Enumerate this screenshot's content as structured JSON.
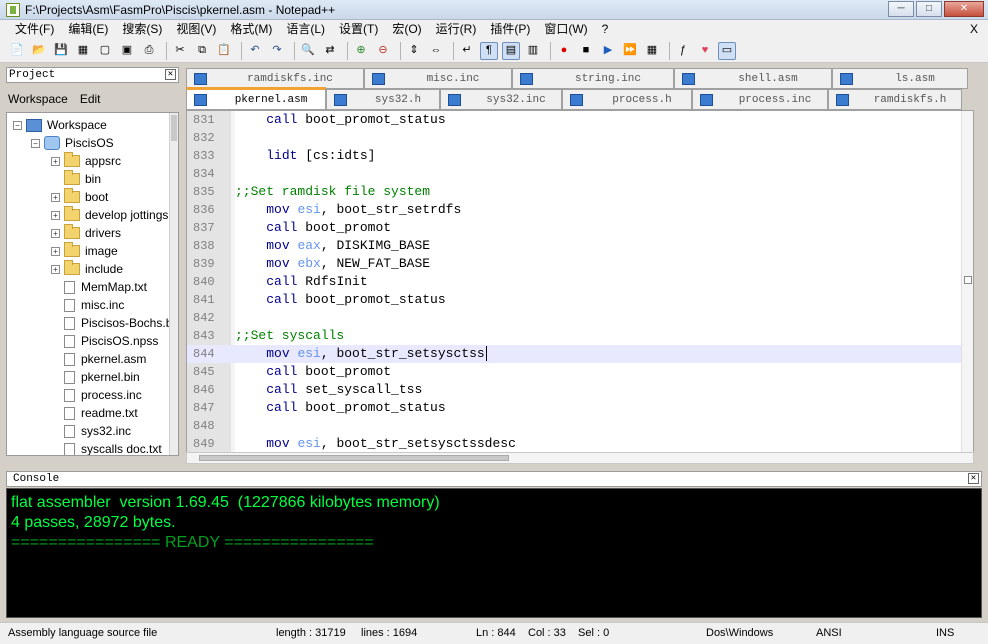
{
  "window": {
    "title": "F:\\Projects\\Asm\\FasmPro\\Piscis\\pkernel.asm - Notepad++",
    "minimize": "─",
    "maximize": "□",
    "close": "✕"
  },
  "menu": {
    "items": [
      "文件(F)",
      "编辑(E)",
      "搜索(S)",
      "视图(V)",
      "格式(M)",
      "语言(L)",
      "设置(T)",
      "宏(O)",
      "运行(R)",
      "插件(P)",
      "窗口(W)",
      "?"
    ],
    "close_label": "X"
  },
  "toolbar": {
    "icons": [
      "new-file-icon",
      "open-file-icon",
      "save-icon",
      "save-all-icon",
      "close-icon",
      "close-all-icon",
      "print-icon",
      "cut-icon",
      "copy-icon",
      "paste-icon",
      "undo-icon",
      "redo-icon",
      "find-icon",
      "replace-icon",
      "zoom-in-icon",
      "zoom-out-icon",
      "sync-v-icon",
      "sync-h-icon",
      "wrap-icon",
      "show-all-chars-icon",
      "indent-guide-icon",
      "doc-map-icon",
      "record-macro-icon",
      "stop-record-icon",
      "play-macro-icon",
      "run-macro-multiple-icon",
      "save-macro-icon",
      "function-list-icon",
      "favorite-icon",
      "console-icon"
    ]
  },
  "project": {
    "header": "Project",
    "menu": [
      "Workspace",
      "Edit"
    ],
    "tree": [
      {
        "label": "Workspace",
        "type": "workspace",
        "level": 0,
        "expander": "−"
      },
      {
        "label": "PiscisOS",
        "type": "project",
        "level": 1,
        "expander": "−"
      },
      {
        "label": "appsrc",
        "type": "folder",
        "level": 2,
        "expander": "+"
      },
      {
        "label": "bin",
        "type": "folder",
        "level": 2,
        "expander": ""
      },
      {
        "label": "boot",
        "type": "folder",
        "level": 2,
        "expander": "+"
      },
      {
        "label": "develop jottings",
        "type": "folder",
        "level": 2,
        "expander": "+"
      },
      {
        "label": "drivers",
        "type": "folder",
        "level": 2,
        "expander": "+"
      },
      {
        "label": "image",
        "type": "folder",
        "level": 2,
        "expander": "+"
      },
      {
        "label": "include",
        "type": "folder",
        "level": 2,
        "expander": "+"
      },
      {
        "label": "MemMap.txt",
        "type": "file",
        "level": 2,
        "expander": ""
      },
      {
        "label": "misc.inc",
        "type": "file",
        "level": 2,
        "expander": ""
      },
      {
        "label": "Piscisos-Bochs.bxrc",
        "type": "file",
        "level": 2,
        "expander": ""
      },
      {
        "label": "PiscisOS.npss",
        "type": "file",
        "level": 2,
        "expander": ""
      },
      {
        "label": "pkernel.asm",
        "type": "file",
        "level": 2,
        "expander": ""
      },
      {
        "label": "pkernel.bin",
        "type": "file",
        "level": 2,
        "expander": ""
      },
      {
        "label": "process.inc",
        "type": "file",
        "level": 2,
        "expander": ""
      },
      {
        "label": "readme.txt",
        "type": "file",
        "level": 2,
        "expander": ""
      },
      {
        "label": "sys32.inc",
        "type": "file",
        "level": 2,
        "expander": ""
      },
      {
        "label": "syscalls doc.txt",
        "type": "file",
        "level": 2,
        "expander": ""
      }
    ]
  },
  "tabs_row1": [
    "ramdiskfs.inc",
    "misc.inc",
    "string.inc",
    "shell.asm",
    "ls.asm"
  ],
  "tabs_row2": [
    "pkernel.asm",
    "sys32.h",
    "sys32.inc",
    "process.h",
    "process.inc",
    "ramdiskfs.h"
  ],
  "active_tab": "pkernel.asm",
  "editor": {
    "lines": [
      {
        "n": "831",
        "ind": "    ",
        "kw": "call",
        "rest": " boot_promot_status",
        "cm": ""
      },
      {
        "n": "832",
        "ind": "",
        "kw": "",
        "rest": "",
        "cm": ""
      },
      {
        "n": "833",
        "ind": "    ",
        "kw": "lidt",
        "rest": " [cs:idts]",
        "cm": ""
      },
      {
        "n": "834",
        "ind": "",
        "kw": "",
        "rest": "",
        "cm": ""
      },
      {
        "n": "835",
        "ind": "",
        "kw": "",
        "rest": "",
        "cm": ";;Set ramdisk file system"
      },
      {
        "n": "836",
        "ind": "    ",
        "kw": "mov",
        "reg": "esi",
        "rest": ", boot_str_setrdfs",
        "cm": ""
      },
      {
        "n": "837",
        "ind": "    ",
        "kw": "call",
        "rest": " boot_promot",
        "cm": ""
      },
      {
        "n": "838",
        "ind": "    ",
        "kw": "mov",
        "reg": "eax",
        "rest": ", DISKIMG_BASE",
        "cm": ""
      },
      {
        "n": "839",
        "ind": "    ",
        "kw": "mov",
        "reg": "ebx",
        "rest": ", NEW_FAT_BASE",
        "cm": ""
      },
      {
        "n": "840",
        "ind": "    ",
        "kw": "call",
        "rest": " RdfsInit",
        "cm": ""
      },
      {
        "n": "841",
        "ind": "    ",
        "kw": "call",
        "rest": " boot_promot_status",
        "cm": ""
      },
      {
        "n": "842",
        "ind": "",
        "kw": "",
        "rest": "",
        "cm": ""
      },
      {
        "n": "843",
        "ind": "",
        "kw": "",
        "rest": "",
        "cm": ";;Set syscalls"
      },
      {
        "n": "844",
        "ind": "    ",
        "kw": "mov",
        "reg": "esi",
        "rest": ", boot_str_setsysctss",
        "cm": "",
        "current": true
      },
      {
        "n": "845",
        "ind": "    ",
        "kw": "call",
        "rest": " boot_promot",
        "cm": ""
      },
      {
        "n": "846",
        "ind": "    ",
        "kw": "call",
        "rest": " set_syscall_tss",
        "cm": ""
      },
      {
        "n": "847",
        "ind": "    ",
        "kw": "call",
        "rest": " boot_promot_status",
        "cm": ""
      },
      {
        "n": "848",
        "ind": "",
        "kw": "",
        "rest": "",
        "cm": ""
      },
      {
        "n": "849",
        "ind": "    ",
        "kw": "mov",
        "reg": "esi",
        "rest": ", boot_str_setsysctssdesc",
        "cm": ""
      }
    ]
  },
  "console": {
    "header": "Console",
    "lines": [
      "flat assembler  version 1.69.45  (1227866 kilobytes memory)",
      "4 passes, 28972 bytes.",
      "================ READY ================"
    ]
  },
  "status": {
    "type": "Assembly language source file",
    "length": "length : 31719",
    "lines": "lines : 1694",
    "ln": "Ln : 844",
    "col": "Col : 33",
    "sel": "Sel : 0",
    "eol": "Dos\\Windows",
    "encoding": "ANSI",
    "mode": "INS"
  },
  "colors": {
    "keyword": "#00008b",
    "register": "#6495ed",
    "comment": "#008000",
    "console_text": "#00ff40",
    "active_tab_accent": "#f0a234"
  }
}
